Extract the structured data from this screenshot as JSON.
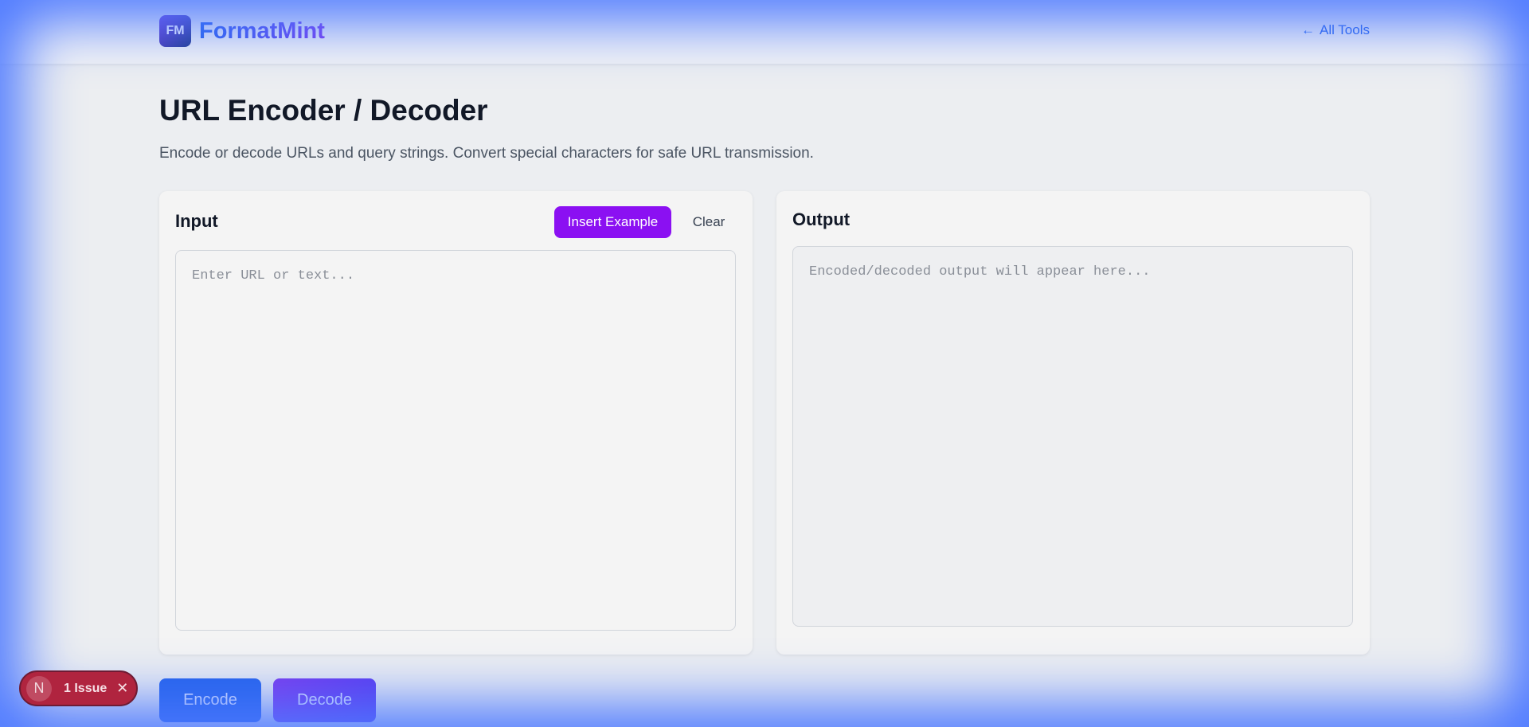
{
  "header": {
    "logo_text": "FM",
    "brand_name": "FormatMint",
    "all_tools_arrow": "←",
    "all_tools_label": "All Tools"
  },
  "main": {
    "title": "URL Encoder / Decoder",
    "description": "Encode or decode URLs and query strings. Convert special characters for safe URL transmission."
  },
  "input_panel": {
    "title": "Input",
    "insert_example_label": "Insert Example",
    "clear_label": "Clear",
    "value": "",
    "placeholder": "Enter URL or text..."
  },
  "output_panel": {
    "title": "Output",
    "value": "",
    "placeholder": "Encoded/decoded output will appear here..."
  },
  "actions": {
    "encode_label": "Encode",
    "decode_label": "Decode"
  },
  "issue_indicator": {
    "letter": "N",
    "text": "1 Issue",
    "close_symbol": "✕"
  },
  "colors": {
    "brand_gradient_start": "#2563eb",
    "brand_gradient_end": "#7c3aed",
    "insert_example_bg": "#8b10f2",
    "encode_bg": "#2563eb",
    "decode_bg": "#7c3aed",
    "issue_bg": "#b0243f",
    "glow": "#4d79ff"
  }
}
